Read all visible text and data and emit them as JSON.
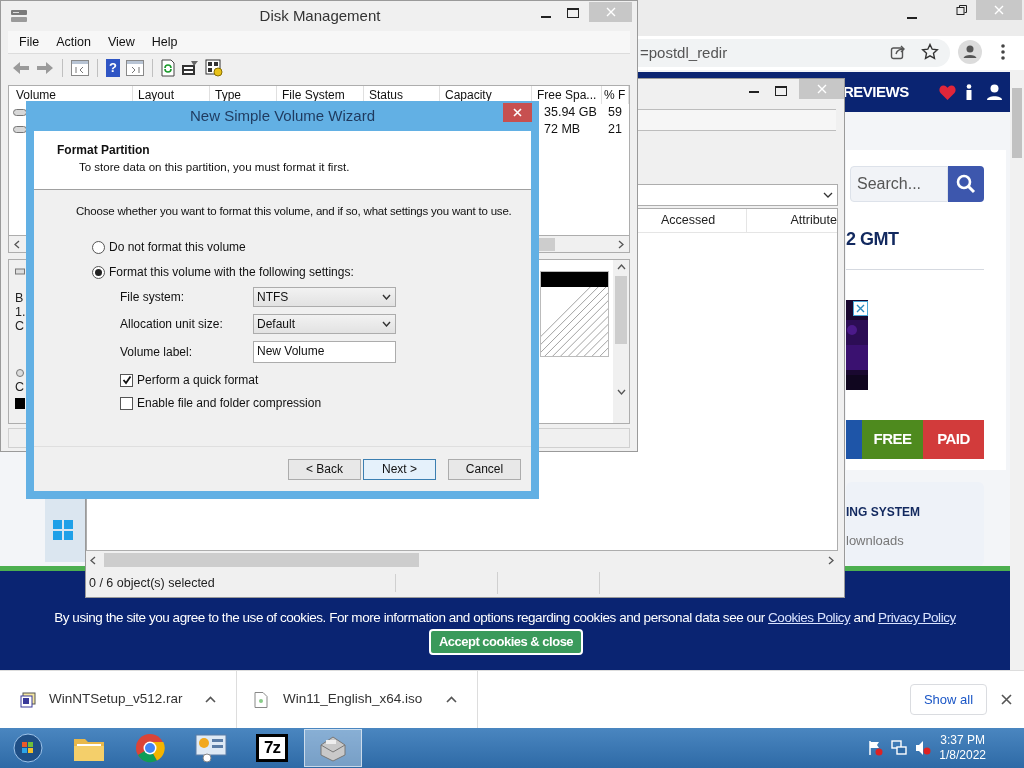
{
  "browser": {
    "address_tail": "=postdl_redir",
    "nav_link": "REVIEWS",
    "search": {
      "placeholder": "Search..."
    },
    "heading_fragment": "2 GMT",
    "tags": [
      {
        "label": "FREE",
        "color": "#4e8a1e"
      },
      {
        "label": "PAID",
        "color": "#d23b3b"
      }
    ],
    "card_title_fragment": "ING SYSTEM",
    "card_text_fragment": "lownloads",
    "cookie_banner": {
      "text": "By using the site you agree to the use of cookies. For more information and options regarding cookies and personal data see our",
      "links": [
        "Cookies Policy",
        "Privacy Policy"
      ],
      "joiner": "and",
      "button": "Accept cookies & close"
    },
    "downloads": [
      {
        "name": "WinNTSetup_v512.rar",
        "kind": "archive"
      },
      {
        "name": "Win11_English_x64.iso",
        "kind": "disc"
      }
    ],
    "show_all": "Show all"
  },
  "explorer": {
    "columns": [
      "Accessed",
      "Attribute"
    ],
    "status": "0 / 6 object(s) selected"
  },
  "disk_management": {
    "title": "Disk Management",
    "menu": [
      "File",
      "Action",
      "View",
      "Help"
    ],
    "toolbar": [
      {
        "kind": "back"
      },
      {
        "kind": "forward"
      },
      {
        "kind": "console"
      },
      {
        "kind": "help",
        "glyph": "?"
      },
      {
        "kind": "pane"
      },
      {
        "kind": "refresh"
      },
      {
        "kind": "properties"
      },
      {
        "kind": "settings"
      }
    ],
    "columns": [
      "Volume",
      "Layout",
      "Type",
      "File System",
      "Status",
      "Capacity",
      "Free Spa...",
      "% F"
    ],
    "rows": [
      {
        "free": "35.94 GB",
        "percent": "59"
      },
      {
        "free": "72 MB",
        "percent": "21"
      }
    ],
    "disk_fragments": [
      "B",
      "1.",
      "C"
    ],
    "disk2_fragment": "C"
  },
  "wizard": {
    "title": "New Simple Volume Wizard",
    "heading": "Format Partition",
    "subheading": "To store data on this partition, you must format it first.",
    "prompt": "Choose whether you want to format this volume, and if so, what settings you want to use.",
    "options": [
      {
        "label": "Do not format this volume",
        "selected": false
      },
      {
        "label": "Format this volume with the following settings:",
        "selected": true
      }
    ],
    "fields": [
      {
        "kind": "select",
        "label": "File system:",
        "value": "NTFS"
      },
      {
        "kind": "select",
        "label": "Allocation unit size:",
        "value": "Default"
      },
      {
        "kind": "text",
        "label": "Volume label:",
        "value": "New Volume"
      }
    ],
    "checkboxes": [
      {
        "label": "Perform a quick format",
        "checked": true
      },
      {
        "label": "Enable file and folder compression",
        "checked": false
      }
    ],
    "buttons": [
      {
        "label": "< Back",
        "default": false
      },
      {
        "label": "Next >",
        "default": true
      },
      {
        "label": "Cancel",
        "default": false
      }
    ]
  },
  "taskbar": {
    "apps": [
      {
        "kind": "folder",
        "selected": false
      },
      {
        "kind": "chrome",
        "selected": false
      },
      {
        "kind": "control-panel",
        "selected": false
      },
      {
        "kind": "sevenzip",
        "glyph": "7z",
        "selected": false
      },
      {
        "kind": "disk-management",
        "selected": true
      }
    ],
    "time": "3:37 PM",
    "date": "1/8/2022"
  }
}
